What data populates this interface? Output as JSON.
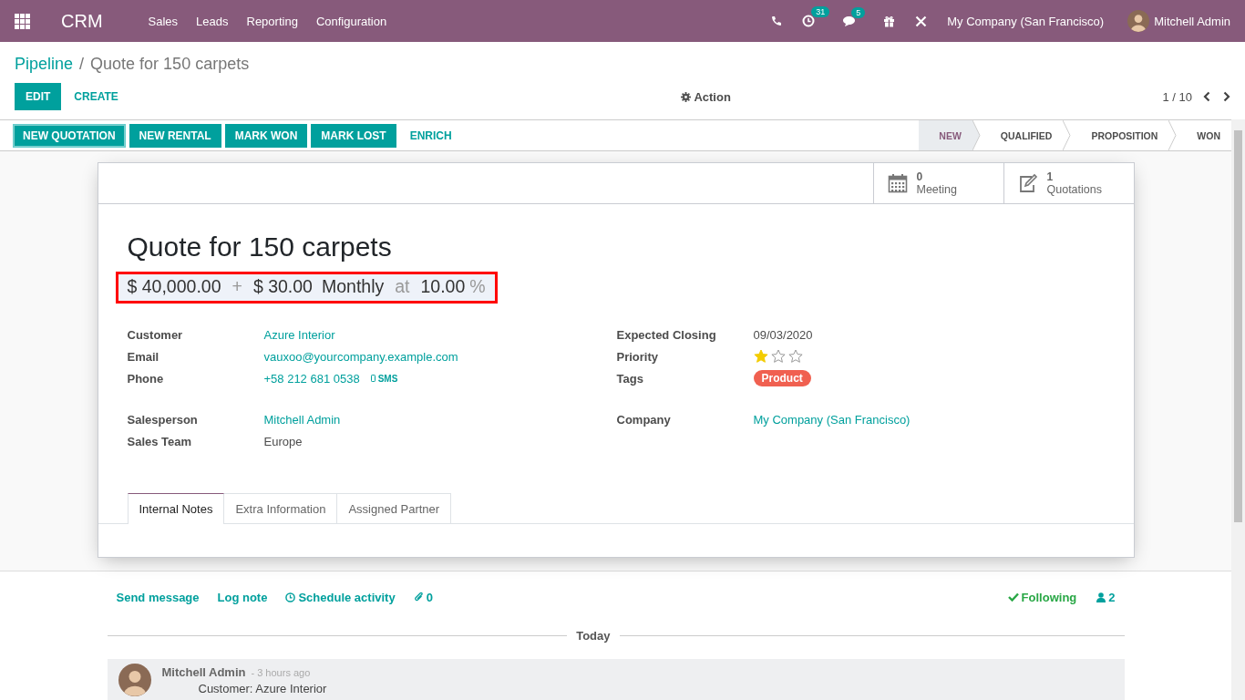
{
  "navbar": {
    "app": "CRM",
    "menus": [
      "Sales",
      "Leads",
      "Reporting",
      "Configuration"
    ],
    "activity_count": "31",
    "message_count": "5",
    "company": "My Company (San Francisco)",
    "user": "Mitchell Admin"
  },
  "breadcrumb": {
    "parent": "Pipeline",
    "separator": "/",
    "current": "Quote for 150 carpets"
  },
  "toolbar": {
    "edit": "EDIT",
    "create": "CREATE",
    "action": "Action",
    "pager": "1 / 10"
  },
  "header_buttons": [
    {
      "label": "NEW QUOTATION",
      "kind": "primary",
      "focused": true
    },
    {
      "label": "NEW RENTAL",
      "kind": "primary",
      "focused": false
    },
    {
      "label": "MARK WON",
      "kind": "primary",
      "focused": false
    },
    {
      "label": "MARK LOST",
      "kind": "primary",
      "focused": false
    },
    {
      "label": "ENRICH",
      "kind": "link",
      "focused": false
    }
  ],
  "stages": [
    {
      "label": "NEW",
      "selected": true
    },
    {
      "label": "QUALIFIED",
      "selected": false
    },
    {
      "label": "PROPOSITION",
      "selected": false
    },
    {
      "label": "WON",
      "selected": false
    }
  ],
  "smart_buttons": [
    {
      "kind": "calendar",
      "value": "0",
      "label": "Meeting"
    },
    {
      "kind": "quote",
      "value": "1",
      "label": "Quotations"
    }
  ],
  "title": "Quote for 150 carpets",
  "revenue": {
    "expected": "$ 40,000.00",
    "plus": "+",
    "recurring": "$ 30.00",
    "plan": "Monthly",
    "at": "at",
    "probability": "10.00",
    "percent": "%"
  },
  "groups": [
    {
      "fields": [
        {
          "label": "Customer",
          "kind": "link",
          "value": "Azure Interior"
        },
        {
          "label": "Email",
          "kind": "link",
          "value": "vauxoo@yourcompany.example.com"
        },
        {
          "label": "Phone",
          "kind": "phone",
          "value": "+58 212 681 0538",
          "action": "SMS"
        }
      ]
    },
    {
      "fields": [
        {
          "label": "Expected Closing",
          "kind": "text",
          "value": "09/03/2020"
        },
        {
          "label": "Priority",
          "kind": "stars",
          "stars": 1
        },
        {
          "label": "Tags",
          "kind": "tag",
          "value": "Product",
          "color": "#f06050"
        }
      ]
    },
    {
      "fields": [
        {
          "label": "Salesperson",
          "kind": "link",
          "value": "Mitchell Admin"
        },
        {
          "label": "Sales Team",
          "kind": "text",
          "value": "Europe"
        }
      ]
    },
    {
      "fields": [
        {
          "label": "Company",
          "kind": "link",
          "value": "My Company (San Francisco)"
        }
      ]
    }
  ],
  "tabs": [
    {
      "label": "Internal Notes",
      "selected": true
    },
    {
      "label": "Extra Information",
      "selected": false
    },
    {
      "label": "Assigned Partner",
      "selected": false
    }
  ],
  "chatter": {
    "actions": [
      {
        "kind": "plain",
        "label": "Send message"
      },
      {
        "kind": "plain",
        "label": "Log note"
      },
      {
        "kind": "clock",
        "label": "Schedule activity"
      },
      {
        "kind": "clip",
        "label": "0"
      }
    ],
    "following": "Following",
    "followers": "2",
    "separator": "Today",
    "message": {
      "author": "Mitchell Admin",
      "time": "- 3 hours ago",
      "body": "Customer: Azure Interior"
    }
  }
}
